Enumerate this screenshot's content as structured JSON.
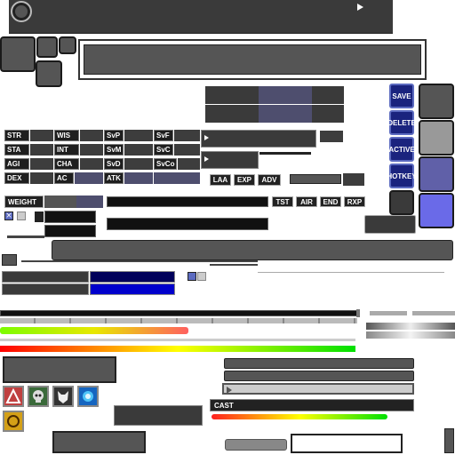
{
  "top_bar": {
    "knob_icon": "circle-knob-icon",
    "arrow_icon": "play-arrow-icon"
  },
  "stats": {
    "row1": [
      "STR",
      "WIS",
      "SvP",
      "SvF"
    ],
    "row2": [
      "STA",
      "INT",
      "SvM",
      "SvC"
    ],
    "row3": [
      "AGI",
      "CHA",
      "SvD",
      "SvCo"
    ],
    "row4": [
      "DEX",
      "AC",
      "ATK"
    ]
  },
  "side_buttons": {
    "save": "SAVE",
    "delete": "DELETE",
    "active": "ACTIVE",
    "hotkey": "HOTKEY"
  },
  "mode_tabs": {
    "laa": "LAA",
    "exp": "EXP",
    "adv": "ADV"
  },
  "weight_label": "WEIGHT",
  "bar_tags": {
    "tst": "TST",
    "air": "AIR",
    "end": "END",
    "rxp": "RXP"
  },
  "cast_label": "CAST",
  "colors": {
    "accent_blue": "#1a237e",
    "mana_blue": "#0000cc",
    "panel_dark": "#3d3d3d",
    "swatch_blue": "#6a6ae8"
  },
  "icons": [
    "claw-icon",
    "skull-icon",
    "wolf-icon",
    "blue-orb-icon",
    "ring-icon"
  ]
}
